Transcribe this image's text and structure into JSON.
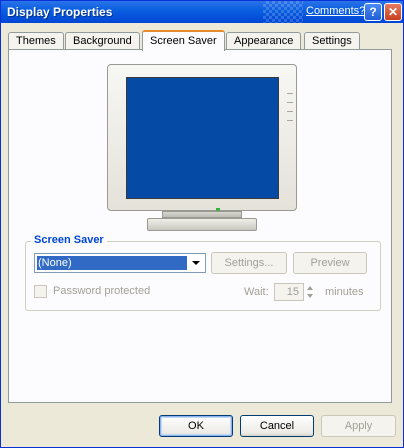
{
  "window": {
    "title": "Display Properties",
    "comments_link": "Comments?",
    "help_glyph": "?",
    "close_glyph": "✕"
  },
  "tabs": [
    {
      "label": "Themes",
      "active": false
    },
    {
      "label": "Background",
      "active": false
    },
    {
      "label": "Screen Saver",
      "active": true
    },
    {
      "label": "Appearance",
      "active": false
    },
    {
      "label": "Settings",
      "active": false
    }
  ],
  "preview": {
    "screen_color": "#054ba5"
  },
  "screen_saver": {
    "group_label": "Screen Saver",
    "selected": "(None)",
    "settings_button": "Settings...",
    "preview_button": "Preview",
    "password_label": "Password protected",
    "wait_label": "Wait:",
    "wait_value": "15",
    "minutes_label": "minutes"
  },
  "footer": {
    "ok": "OK",
    "cancel": "Cancel",
    "apply": "Apply"
  },
  "colors": {
    "title_bar": "#0a5fe0",
    "active_tab_accent": "#e68b2c",
    "selection": "#316ac5",
    "group_label": "#0046d5"
  }
}
